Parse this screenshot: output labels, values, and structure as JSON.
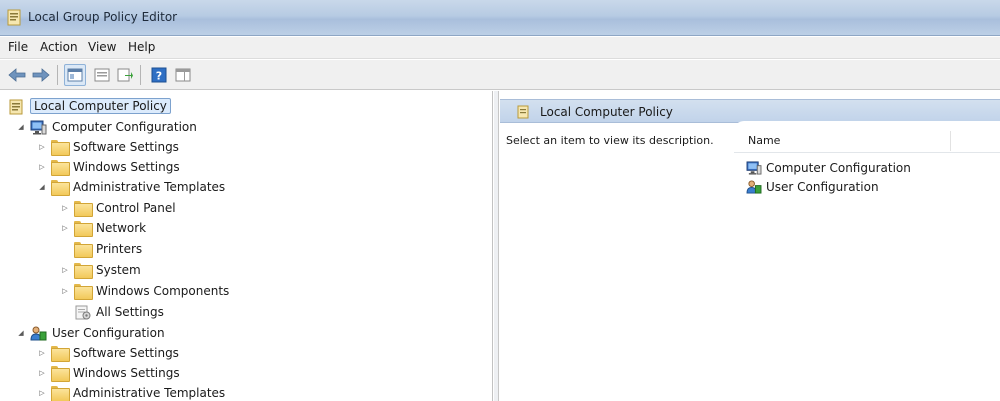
{
  "window": {
    "title": "Local Group Policy Editor",
    "app_icon": "policy-icon"
  },
  "menu": {
    "items": [
      "File",
      "Action",
      "View",
      "Help"
    ]
  },
  "toolbar": {
    "buttons": [
      {
        "icon": "back-arrow-icon"
      },
      {
        "icon": "forward-arrow-icon"
      },
      {
        "icon": "show-hide-tree-icon"
      },
      {
        "icon": "properties-icon"
      },
      {
        "icon": "export-list-icon"
      },
      {
        "icon": "help-icon"
      },
      {
        "icon": "show-action-pane-icon"
      }
    ]
  },
  "tree": {
    "items": [
      {
        "label": "Local Computer Policy",
        "icon": "policy-icon",
        "toggle": "",
        "selected": true
      },
      {
        "label": "Computer Configuration",
        "icon": "computer-config-icon",
        "toggle": "expanded"
      },
      {
        "label": "Software Settings",
        "icon": "folder-icon",
        "toggle": "collapsed"
      },
      {
        "label": "Windows Settings",
        "icon": "folder-icon",
        "toggle": "collapsed"
      },
      {
        "label": "Administrative Templates",
        "icon": "folder-icon",
        "toggle": "expanded"
      },
      {
        "label": "Control Panel",
        "icon": "folder-icon",
        "toggle": "collapsed"
      },
      {
        "label": "Network",
        "icon": "folder-icon",
        "toggle": "collapsed"
      },
      {
        "label": "Printers",
        "icon": "folder-icon",
        "toggle": ""
      },
      {
        "label": "System",
        "icon": "folder-icon",
        "toggle": "collapsed"
      },
      {
        "label": "Windows Components",
        "icon": "folder-icon",
        "toggle": "collapsed"
      },
      {
        "label": "All Settings",
        "icon": "all-settings-icon",
        "toggle": ""
      },
      {
        "label": "User Configuration",
        "icon": "user-config-icon",
        "toggle": "expanded"
      },
      {
        "label": "Software Settings",
        "icon": "folder-icon",
        "toggle": "collapsed"
      },
      {
        "label": "Windows Settings",
        "icon": "folder-icon",
        "toggle": "collapsed"
      },
      {
        "label": "Administrative Templates",
        "icon": "folder-icon",
        "toggle": "collapsed"
      }
    ]
  },
  "right_pane": {
    "header_title": "Local Computer Policy",
    "description": "Select an item to view its description.",
    "column_name": "Name",
    "items": [
      {
        "label": "Computer Configuration",
        "icon": "computer-config-icon"
      },
      {
        "label": "User Configuration",
        "icon": "user-config-icon"
      }
    ]
  },
  "colors": {
    "selection": "#dcebfc",
    "selection_border": "#7da2ce",
    "header_bg": "#c1d3ea",
    "folder": "#f2c95a"
  }
}
